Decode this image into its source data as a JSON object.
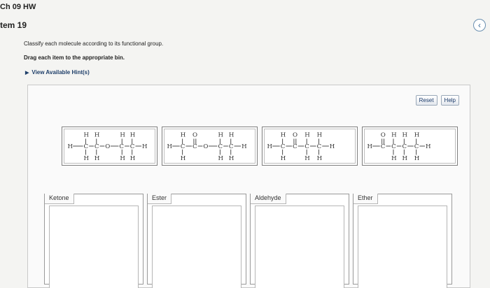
{
  "header": {
    "title": "Ch 09 HW",
    "item": "tem 19"
  },
  "instructions": {
    "line1": "Classify each molecule according to its functional group.",
    "line2": "Drag each item to the appropriate bin."
  },
  "hints": {
    "label": "View Available Hint(s)"
  },
  "toolbar": {
    "reset_label": "Reset",
    "help_label": "Help"
  },
  "bins": [
    {
      "label": "Ketone"
    },
    {
      "label": "Ester"
    },
    {
      "label": "Aldehyde"
    },
    {
      "label": "Ether"
    }
  ],
  "colors": {
    "link": "#1f3f6a",
    "panel_border": "#c9c9c9",
    "bin_border": "#9a9a9a"
  },
  "icons": {
    "back": "chevron-left-icon",
    "hints": "triangle-right-icon"
  }
}
